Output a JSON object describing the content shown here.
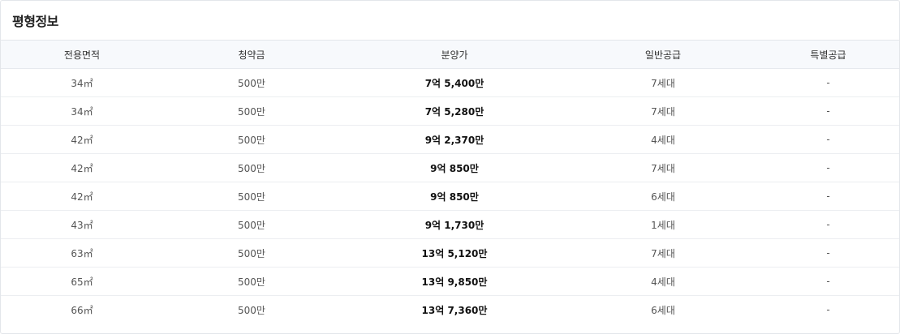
{
  "panel": {
    "title": "평형정보"
  },
  "table": {
    "headers": [
      "전용면적",
      "청약금",
      "분양가",
      "일반공급",
      "특별공급"
    ],
    "rows": [
      [
        "34㎡",
        "500만",
        "7억 5,400만",
        "7세대",
        "-"
      ],
      [
        "34㎡",
        "500만",
        "7억 5,280만",
        "7세대",
        "-"
      ],
      [
        "42㎡",
        "500만",
        "9억 2,370만",
        "4세대",
        "-"
      ],
      [
        "42㎡",
        "500만",
        "9억 850만",
        "7세대",
        "-"
      ],
      [
        "42㎡",
        "500만",
        "9억 850만",
        "6세대",
        "-"
      ],
      [
        "43㎡",
        "500만",
        "9억 1,730만",
        "1세대",
        "-"
      ],
      [
        "63㎡",
        "500만",
        "13억 5,120만",
        "7세대",
        "-"
      ],
      [
        "65㎡",
        "500만",
        "13억 9,850만",
        "4세대",
        "-"
      ],
      [
        "66㎡",
        "500만",
        "13억 7,360만",
        "6세대",
        "-"
      ]
    ]
  }
}
